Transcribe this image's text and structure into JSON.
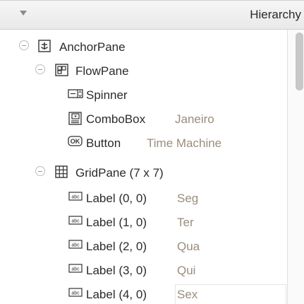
{
  "panel": {
    "title": "Hierarchy"
  },
  "tree": [
    {
      "name": "AnchorPane",
      "value": "",
      "icon": "anchor-pane-icon"
    },
    {
      "name": "FlowPane",
      "value": "",
      "icon": "flow-pane-icon"
    },
    {
      "name": "Spinner",
      "value": "",
      "icon": "spinner-icon"
    },
    {
      "name": "ComboBox",
      "value": "Janeiro",
      "icon": "combobox-icon"
    },
    {
      "name": "Button",
      "value": "Time Machine",
      "icon": "button-ok-icon"
    },
    {
      "name": "GridPane (7 x 7)",
      "value": "",
      "icon": "grid-pane-icon"
    },
    {
      "name": "Label (0, 0)",
      "value": "Seg",
      "icon": "label-icon"
    },
    {
      "name": "Label (1, 0)",
      "value": "Ter",
      "icon": "label-icon"
    },
    {
      "name": "Label (2, 0)",
      "value": "Qua",
      "icon": "label-icon"
    },
    {
      "name": "Label (3, 0)",
      "value": "Qui",
      "icon": "label-icon"
    },
    {
      "name": "Label (4, 0)",
      "value": "Sex",
      "icon": "label-icon"
    }
  ]
}
